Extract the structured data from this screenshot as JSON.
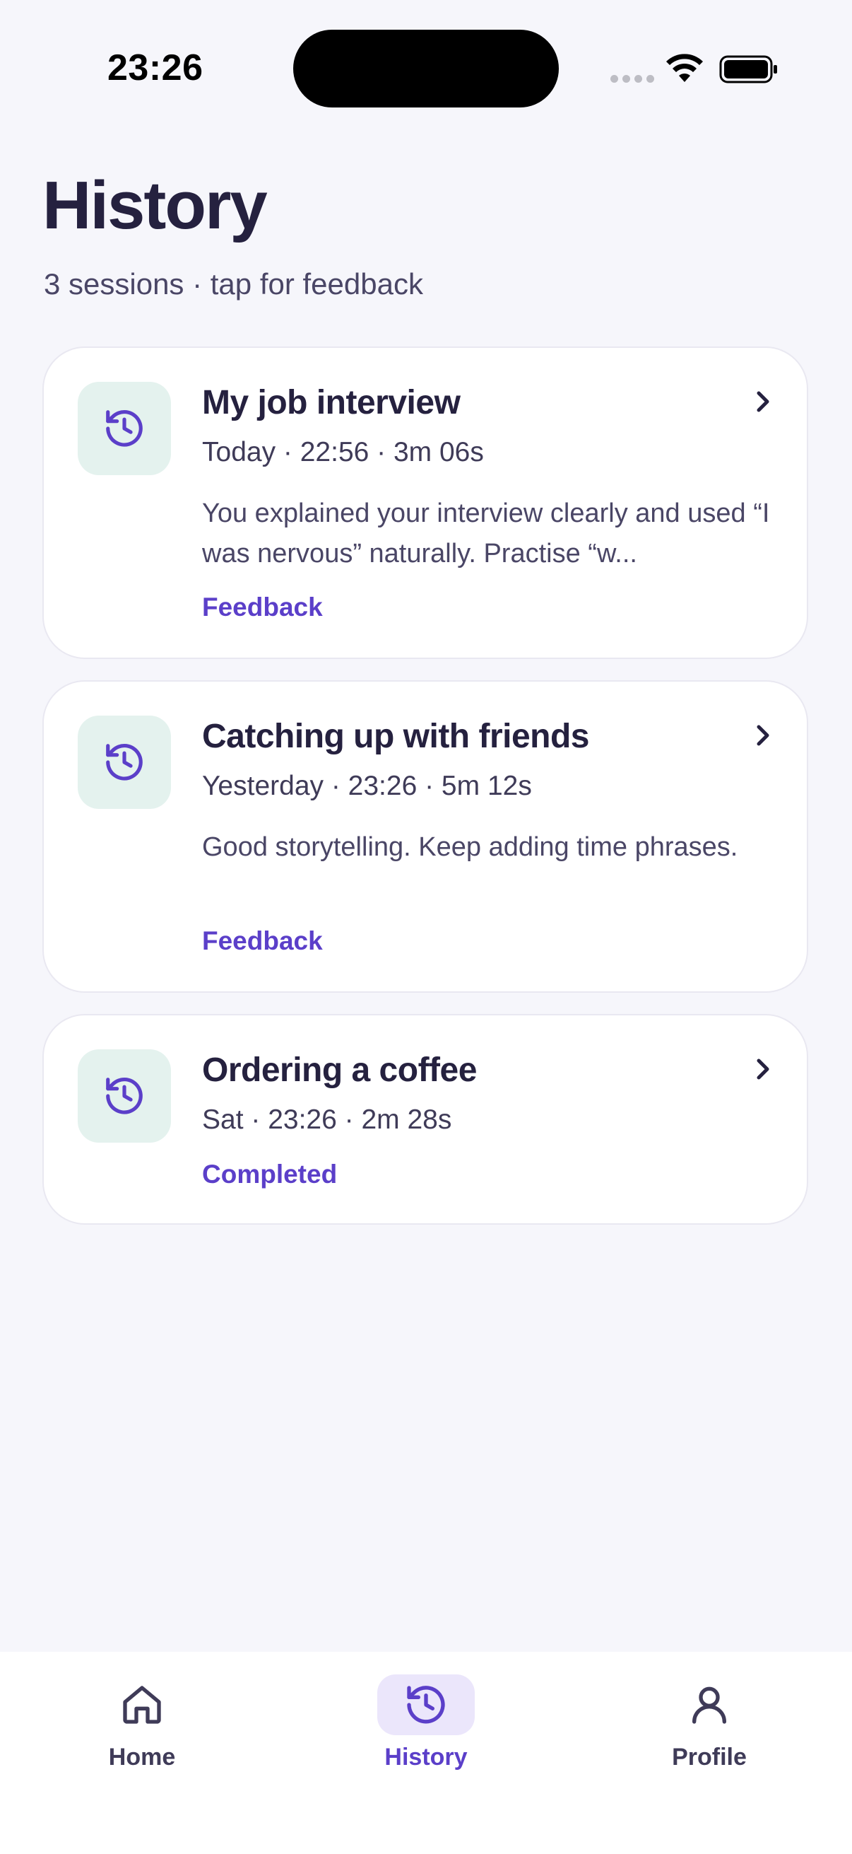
{
  "status_bar": {
    "time": "23:26"
  },
  "header": {
    "title": "History",
    "subtitle": "3 sessions · tap for feedback"
  },
  "sessions": [
    {
      "title": "My job interview",
      "meta": "Today · 22:56 · 3m 06s",
      "summary": "You explained your interview clearly and used “I was nervous” naturally. Practise “w...",
      "action": "Feedback",
      "icon": "history-icon"
    },
    {
      "title": "Catching up with friends",
      "meta": "Yesterday · 23:26 · 5m 12s",
      "summary": "Good storytelling. Keep adding time phrases.",
      "action": "Feedback",
      "icon": "history-icon"
    },
    {
      "title": "Ordering a coffee",
      "meta": "Sat · 23:26 · 2m 28s",
      "action": "Completed",
      "icon": "history-icon"
    }
  ],
  "tab_bar": {
    "items": [
      {
        "label": "Home",
        "icon": "home-icon",
        "active": false
      },
      {
        "label": "History",
        "icon": "history-icon",
        "active": true
      },
      {
        "label": "Profile",
        "icon": "profile-icon",
        "active": false
      }
    ]
  },
  "colors": {
    "accent": "#5b3fc9",
    "icon_tile": "#e4f2ee",
    "active_tab_bg": "#ebe6fb",
    "text_primary": "#25213f",
    "background": "#f6f6fb"
  }
}
